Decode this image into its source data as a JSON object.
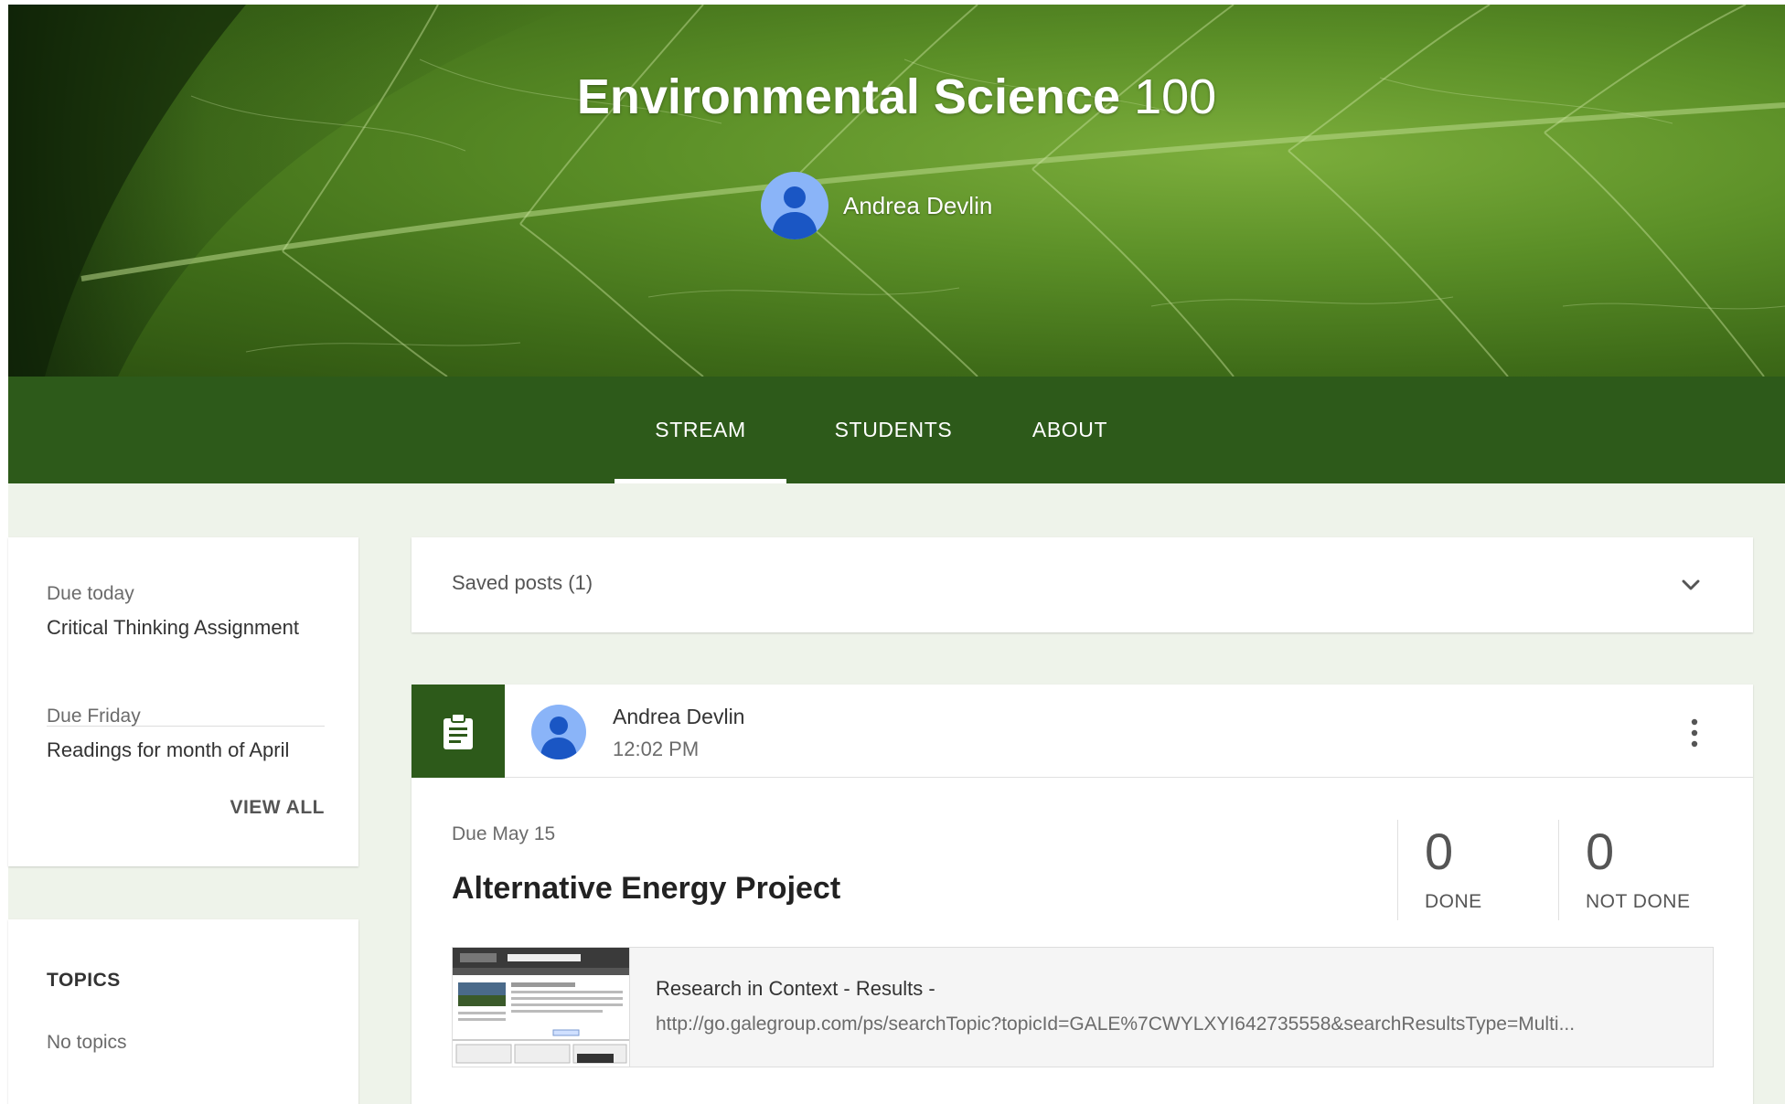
{
  "course": {
    "title_name": "Environmental Science",
    "title_number": "100",
    "teacher": "Andrea Devlin"
  },
  "nav": {
    "tabs": [
      {
        "label": "STREAM",
        "active": true
      },
      {
        "label": "STUDENTS",
        "active": false
      },
      {
        "label": "ABOUT",
        "active": false
      }
    ]
  },
  "upcoming": {
    "items": [
      {
        "due": "Due today",
        "title": "Critical Thinking Assignment"
      },
      {
        "due": "Due Friday",
        "title": "Readings for month of April"
      }
    ],
    "view_all": "VIEW ALL"
  },
  "topics": {
    "title": "TOPICS",
    "empty": "No topics"
  },
  "saved_posts": {
    "label": "Saved posts (1)"
  },
  "post": {
    "author": "Andrea Devlin",
    "time": "12:02 PM",
    "due": "Due May 15",
    "title": "Alternative Energy Project",
    "done_count": "0",
    "done_label": "DONE",
    "not_done_count": "0",
    "not_done_label": "NOT DONE",
    "attachment": {
      "title": "Research in Context - Results -",
      "url": "http://go.galegroup.com/ps/searchTopic?topicId=GALE%7CWYLXYI642735558&searchResultsType=Multi..."
    }
  },
  "icons": {
    "avatar": "person-avatar-icon",
    "assignment": "assignment-icon",
    "chevron": "chevron-down-icon",
    "menu": "more-vert-icon"
  },
  "colors": {
    "nav_green": "#2d5a1a",
    "content_bg": "#eef3ea",
    "avatar_blue": "#8ab4f8"
  }
}
